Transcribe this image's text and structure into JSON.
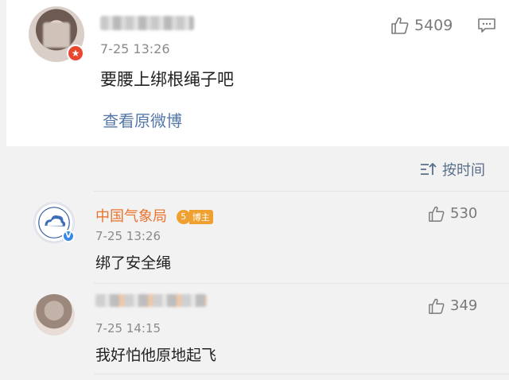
{
  "main_comment": {
    "timestamp": "7-25 13:26",
    "text": "要腰上绑根绳子吧",
    "like_count": "5409",
    "view_original_label": "查看原微博"
  },
  "sort": {
    "label": "按时间"
  },
  "replies": [
    {
      "name": "中国气象局",
      "badge": "博主",
      "badge_level": "5",
      "timestamp": "7-25 13:26",
      "text": "绑了安全绳",
      "like_count": "530"
    },
    {
      "timestamp": "7-25 14:15",
      "text": "我好怕他原地起飞",
      "like_count": "349"
    }
  ],
  "colors": {
    "link": "#5477a8",
    "username_orange": "#e8742e",
    "badge_orange": "#f0a030",
    "verified_blue": "#3b89e5",
    "vip_red": "#e8462f"
  },
  "icons": [
    "thumbs-up-icon",
    "comment-icon",
    "sort-icon",
    "verified-icon",
    "vip-icon"
  ]
}
